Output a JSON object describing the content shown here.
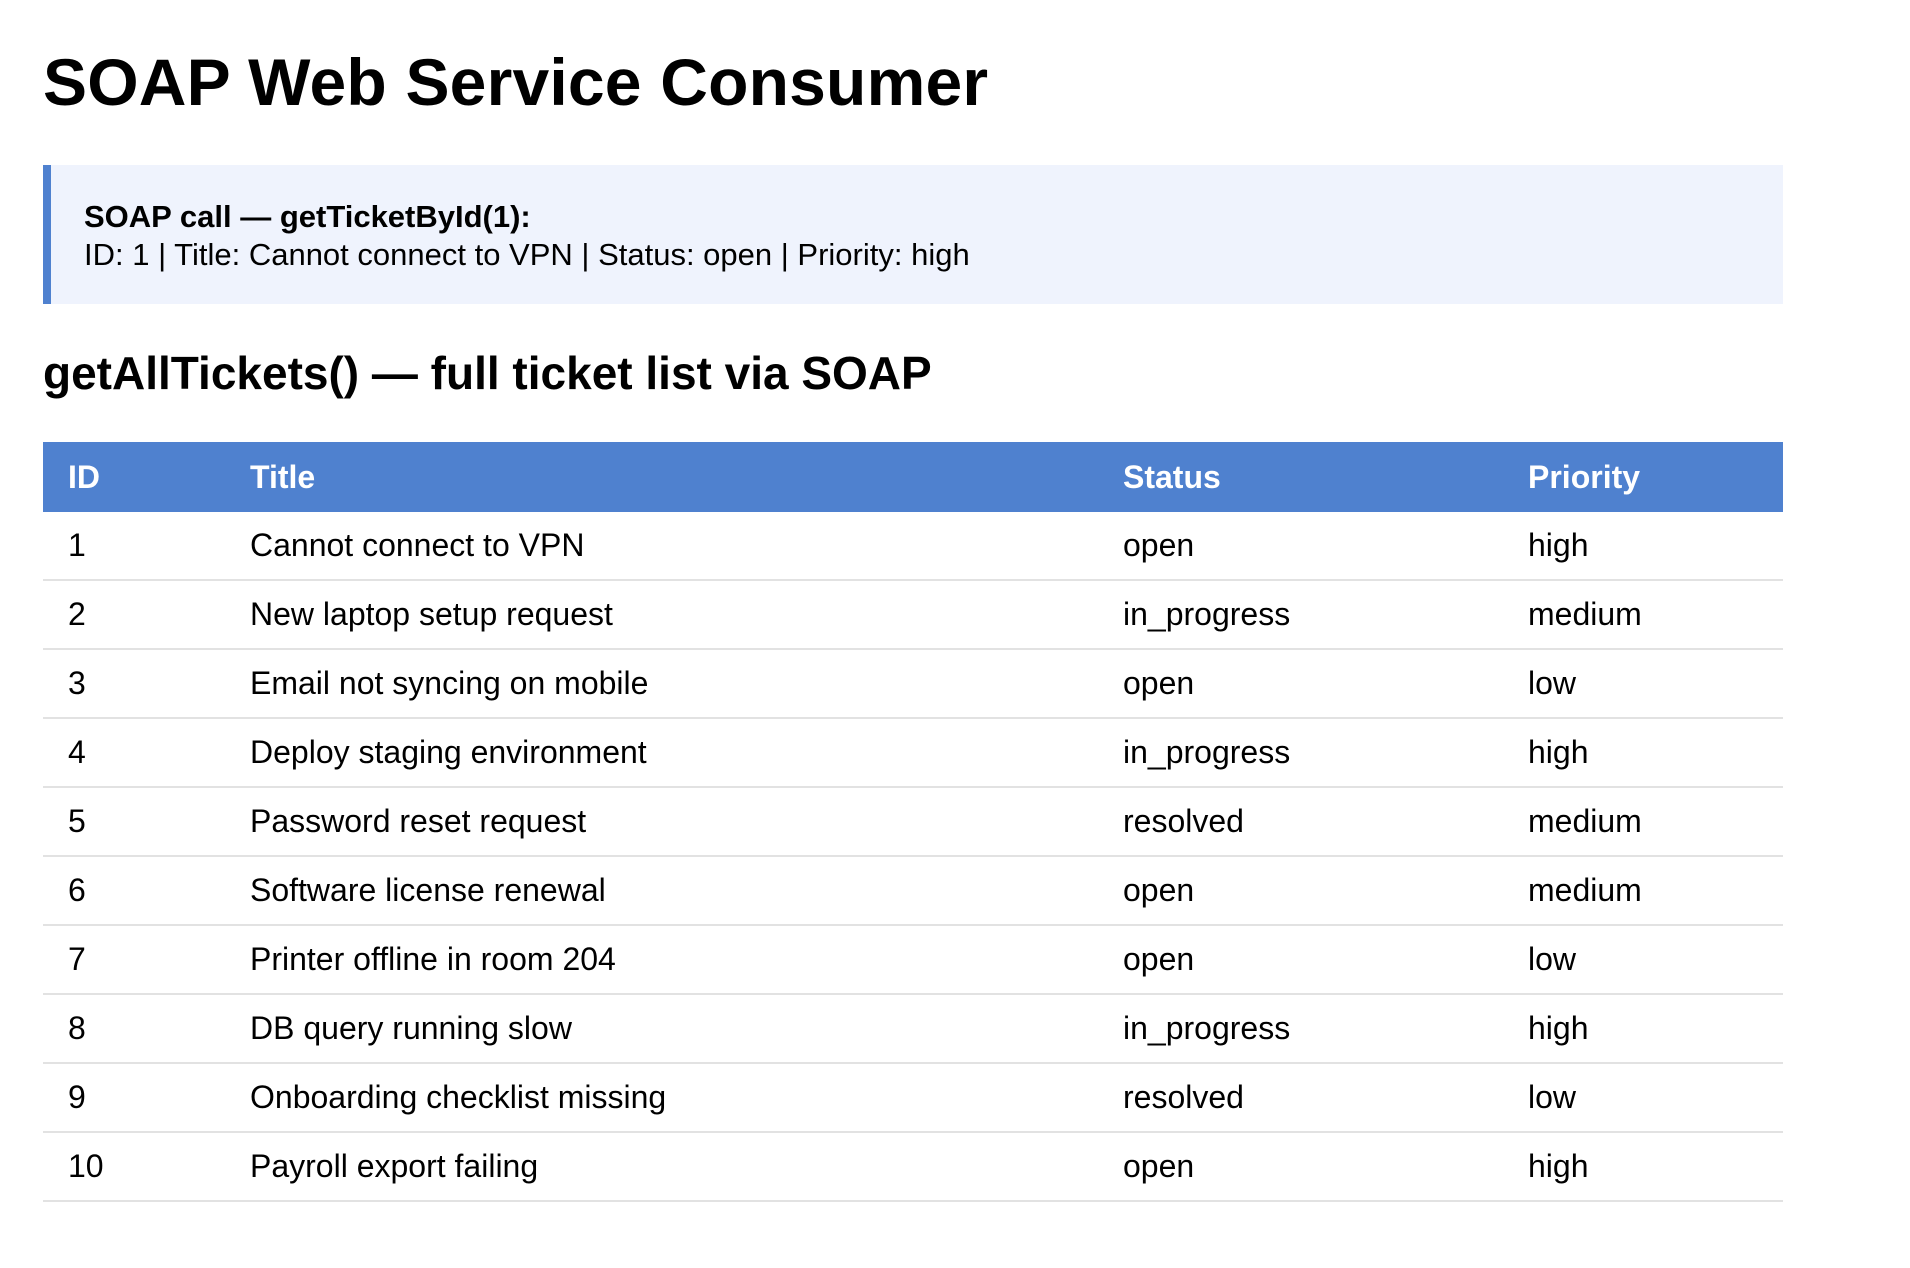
{
  "page": {
    "title": "SOAP Web Service Consumer"
  },
  "single_call": {
    "label": "SOAP call — getTicketById(1):",
    "result": "ID: 1 | Title: Cannot connect to VPN | Status: open | Priority: high"
  },
  "list_section": {
    "title": "getAllTickets() — full ticket list via SOAP"
  },
  "table": {
    "headers": [
      "ID",
      "Title",
      "Status",
      "Priority"
    ],
    "rows": [
      [
        "1",
        "Cannot connect to VPN",
        "open",
        "high"
      ],
      [
        "2",
        "New laptop setup request",
        "in_progress",
        "medium"
      ],
      [
        "3",
        "Email not syncing on mobile",
        "open",
        "low"
      ],
      [
        "4",
        "Deploy staging environment",
        "in_progress",
        "high"
      ],
      [
        "5",
        "Password reset request",
        "resolved",
        "medium"
      ],
      [
        "6",
        "Software license renewal",
        "open",
        "medium"
      ],
      [
        "7",
        "Printer offline in room 204",
        "open",
        "low"
      ],
      [
        "8",
        "DB query running slow",
        "in_progress",
        "high"
      ],
      [
        "9",
        "Onboarding checklist missing",
        "resolved",
        "low"
      ],
      [
        "10",
        "Payroll export failing",
        "open",
        "high"
      ]
    ]
  },
  "colors": {
    "accent": "#4f81cf",
    "panel_background": "#eff3fd",
    "row_divider": "#e2e2e2"
  }
}
